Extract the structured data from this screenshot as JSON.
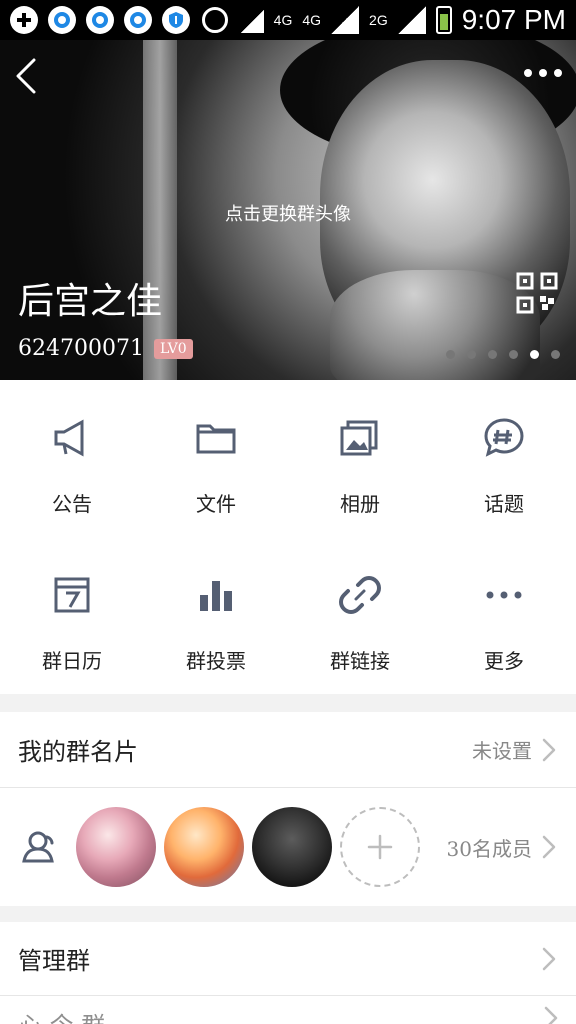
{
  "status": {
    "network_1": "4G",
    "network_2": "4G",
    "network_3": "2G",
    "time": "9:07 PM"
  },
  "hero": {
    "hint": "点击更换群头像",
    "group_name": "后宫之佳",
    "group_id": "624700071",
    "level": "LV0",
    "dots_total": 6,
    "dots_active_index": 4
  },
  "grid": {
    "row1": [
      {
        "label": "公告",
        "icon": "megaphone-icon"
      },
      {
        "label": "文件",
        "icon": "folder-icon"
      },
      {
        "label": "相册",
        "icon": "photo-album-icon"
      },
      {
        "label": "话题",
        "icon": "topic-icon"
      }
    ],
    "row2": [
      {
        "label": "群日历",
        "icon": "calendar-icon"
      },
      {
        "label": "群投票",
        "icon": "vote-icon"
      },
      {
        "label": "群链接",
        "icon": "link-icon"
      },
      {
        "label": "更多",
        "icon": "more-icon"
      }
    ]
  },
  "group_card": {
    "title": "我的群名片",
    "value": "未设置"
  },
  "members": {
    "count": "30名成员"
  },
  "manage": {
    "title": "管理群"
  },
  "bottom": {
    "partial": "心 今 群"
  }
}
